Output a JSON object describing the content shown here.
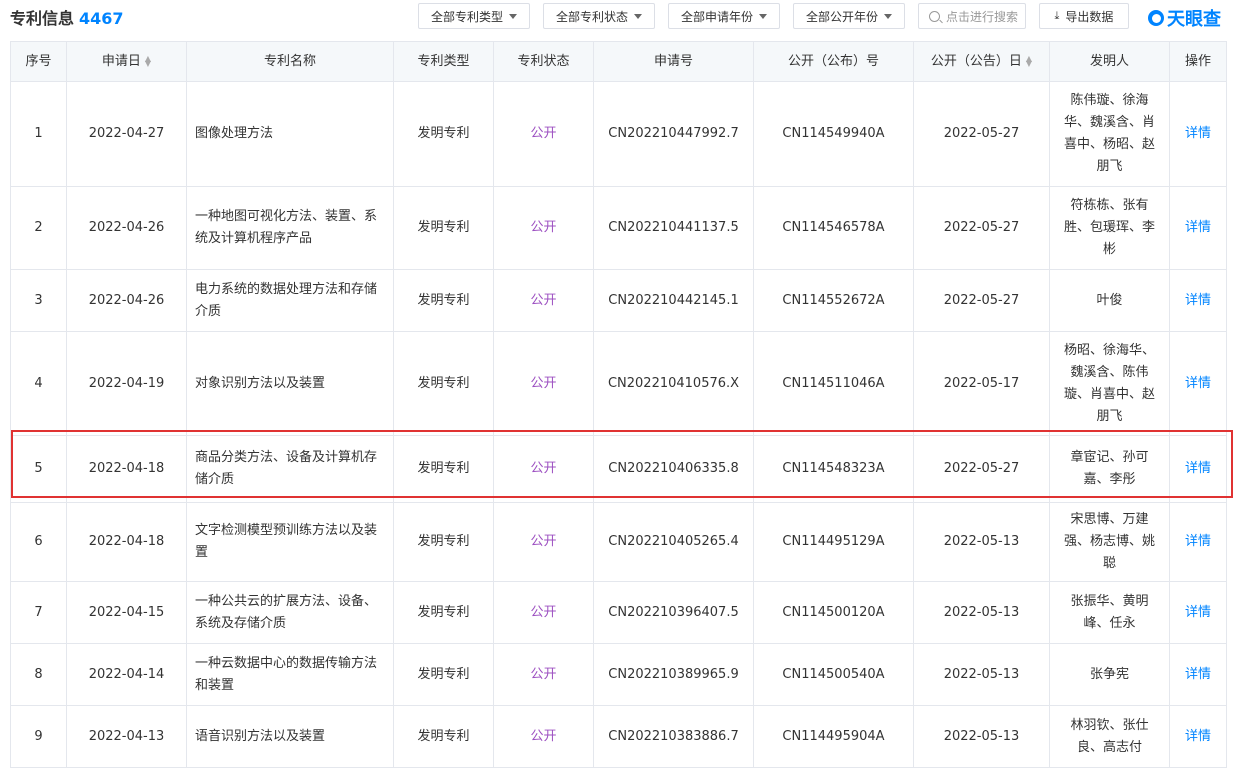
{
  "header": {
    "title": "专利信息",
    "count": "4467",
    "filters": [
      "全部专利类型",
      "全部专利状态",
      "全部申请年份",
      "全部公开年份"
    ],
    "search_placeholder": "点击进行搜索",
    "export_label": "导出数据",
    "logo_text": "天眼查"
  },
  "table": {
    "columns": [
      "序号",
      "申请日",
      "专利名称",
      "专利类型",
      "专利状态",
      "申请号",
      "公开（公布）号",
      "公开（公告）日",
      "发明人",
      "操作"
    ],
    "rows": [
      {
        "no": "1",
        "apply_date": "2022-04-27",
        "name": "图像处理方法",
        "type": "发明专利",
        "status": "公开",
        "apply_no": "CN202210447992.7",
        "pub_no": "CN114549940A",
        "pub_date": "2022-05-27",
        "inventors": "陈伟璇、徐海华、魏溪含、肖喜中、杨昭、赵朋飞",
        "action": "详情"
      },
      {
        "no": "2",
        "apply_date": "2022-04-26",
        "name": "一种地图可视化方法、装置、系统及计算机程序产品",
        "type": "发明专利",
        "status": "公开",
        "apply_no": "CN202210441137.5",
        "pub_no": "CN114546578A",
        "pub_date": "2022-05-27",
        "inventors": "符栋栋、张有胜、包瑗珲、李彬",
        "action": "详情"
      },
      {
        "no": "3",
        "apply_date": "2022-04-26",
        "name": "电力系统的数据处理方法和存储介质",
        "type": "发明专利",
        "status": "公开",
        "apply_no": "CN202210442145.1",
        "pub_no": "CN114552672A",
        "pub_date": "2022-05-27",
        "inventors": "叶俊",
        "action": "详情"
      },
      {
        "no": "4",
        "apply_date": "2022-04-19",
        "name": "对象识别方法以及装置",
        "type": "发明专利",
        "status": "公开",
        "apply_no": "CN202210410576.X",
        "pub_no": "CN114511046A",
        "pub_date": "2022-05-17",
        "inventors": "杨昭、徐海华、魏溪含、陈伟璇、肖喜中、赵朋飞",
        "action": "详情"
      },
      {
        "no": "5",
        "apply_date": "2022-04-18",
        "name": "商品分类方法、设备及计算机存储介质",
        "type": "发明专利",
        "status": "公开",
        "apply_no": "CN202210406335.8",
        "pub_no": "CN114548323A",
        "pub_date": "2022-05-27",
        "inventors": "章宦记、孙可嘉、李彤",
        "action": "详情"
      },
      {
        "no": "6",
        "apply_date": "2022-04-18",
        "name": "文字检测模型预训练方法以及装置",
        "type": "发明专利",
        "status": "公开",
        "apply_no": "CN202210405265.4",
        "pub_no": "CN114495129A",
        "pub_date": "2022-05-13",
        "inventors": "宋思博、万建强、杨志博、姚聪",
        "action": "详情"
      },
      {
        "no": "7",
        "apply_date": "2022-04-15",
        "name": "一种公共云的扩展方法、设备、系统及存储介质",
        "type": "发明专利",
        "status": "公开",
        "apply_no": "CN202210396407.5",
        "pub_no": "CN114500120A",
        "pub_date": "2022-05-13",
        "inventors": "张振华、黄明峰、任永",
        "action": "详情"
      },
      {
        "no": "8",
        "apply_date": "2022-04-14",
        "name": "一种云数据中心的数据传输方法和装置",
        "type": "发明专利",
        "status": "公开",
        "apply_no": "CN202210389965.9",
        "pub_no": "CN114500540A",
        "pub_date": "2022-05-13",
        "inventors": "张争宪",
        "action": "详情"
      },
      {
        "no": "9",
        "apply_date": "2022-04-13",
        "name": "语音识别方法以及装置",
        "type": "发明专利",
        "status": "公开",
        "apply_no": "CN202210383886.7",
        "pub_no": "CN114495904A",
        "pub_date": "2022-05-13",
        "inventors": "林羽钦、张仕良、高志付",
        "action": "详情"
      }
    ]
  },
  "colors": {
    "accent": "#0084ff",
    "status": "#9c4fc1",
    "highlight": "#e03232"
  }
}
